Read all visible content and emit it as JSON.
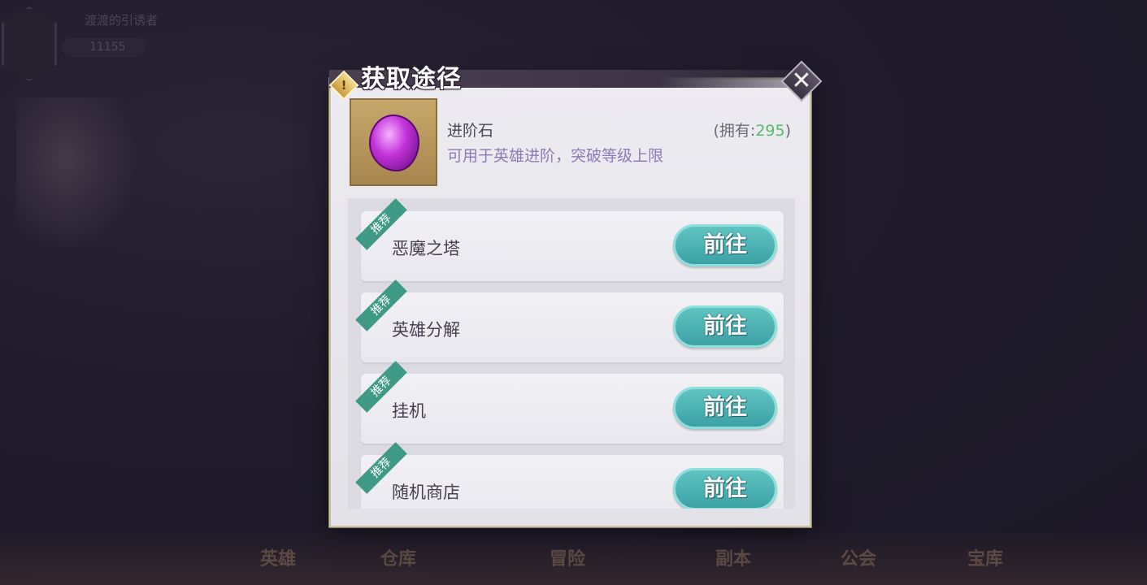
{
  "background": {
    "player_name": "渡渡的引诱者",
    "player_power": "11155",
    "nav": [
      "英雄",
      "仓库",
      "冒险",
      "副本",
      "公会",
      "宝库"
    ]
  },
  "dialog": {
    "title": "获取途径",
    "warning_glyph": "!",
    "close_glyph": "✕",
    "item": {
      "name": "进阶石",
      "owned_prefix": "(拥有:",
      "owned_count": "295",
      "owned_suffix": ")",
      "description": "可用于英雄进阶，突破等级上限"
    },
    "sources": [
      {
        "tag": "推荐",
        "label": "恶魔之塔",
        "button": "前往"
      },
      {
        "tag": "推荐",
        "label": "英雄分解",
        "button": "前往"
      },
      {
        "tag": "推荐",
        "label": "挂机",
        "button": "前往"
      },
      {
        "tag": "推荐",
        "label": "随机商店",
        "button": "前往"
      }
    ]
  },
  "colors": {
    "accent_teal": "#3a9fa4",
    "owned_green": "#5ab96a",
    "description_purple": "#8c7bb3",
    "gem_purple": "#c233d9"
  }
}
